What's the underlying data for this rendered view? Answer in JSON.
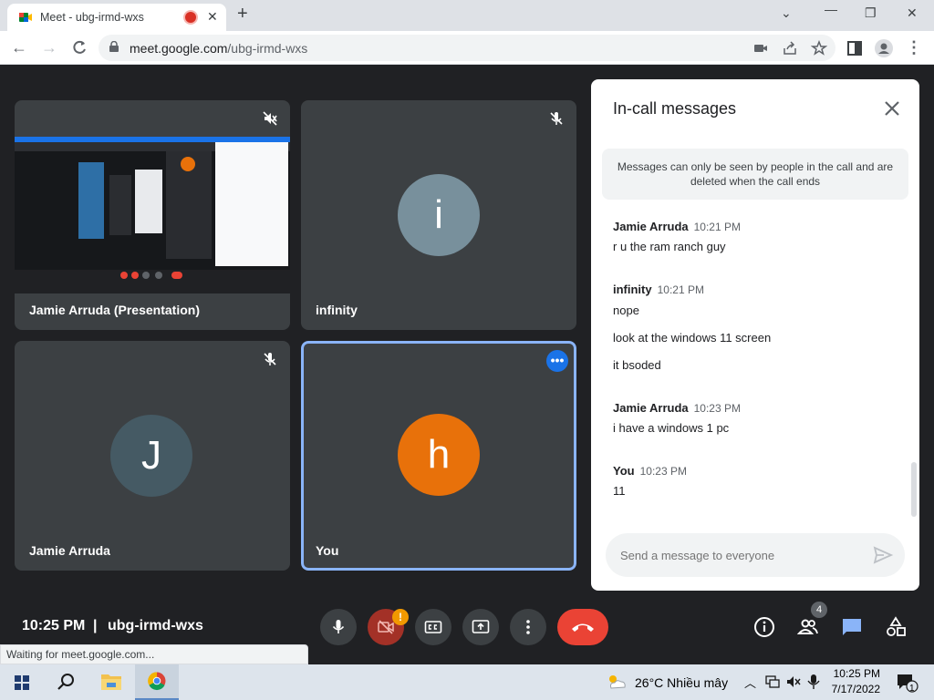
{
  "browser": {
    "tab_title": "Meet - ubg-irmd-wxs",
    "url_host": "meet.google.com",
    "url_path": "/ubg-irmd-wxs",
    "status_text": "Waiting for meet.google.com..."
  },
  "tiles": [
    {
      "name": "Jamie Arruda (Presentation)",
      "muted": true
    },
    {
      "name": "infinity",
      "initial": "i",
      "muted": true
    },
    {
      "name": "Jamie Arruda",
      "initial": "J",
      "muted": true
    },
    {
      "name": "You",
      "initial": "h"
    }
  ],
  "chat": {
    "title": "In-call messages",
    "notice": "Messages can only be seen by people in the call and are deleted when the call ends",
    "groups": [
      {
        "sender": "Jamie Arruda",
        "time": "10:21 PM",
        "messages": [
          "r u the ram ranch guy"
        ]
      },
      {
        "sender": "infinity",
        "time": "10:21 PM",
        "messages": [
          "nope",
          "look at the windows 11 screen",
          "it bsoded"
        ]
      },
      {
        "sender": "Jamie Arruda",
        "time": "10:23 PM",
        "messages": [
          "i have a windows 1 pc"
        ]
      },
      {
        "sender": "You",
        "time": "10:23 PM",
        "messages": [
          "11"
        ]
      }
    ],
    "input_placeholder": "Send a message to everyone"
  },
  "controls": {
    "clock": "10:25 PM",
    "separator": "|",
    "meeting_code": "ubg-irmd-wxs",
    "camera_warning": "!",
    "people_count": "4"
  },
  "taskbar": {
    "weather": "26°C  Nhiều mây",
    "time": "10:25 PM",
    "date": "7/17/2022",
    "notification_count": "1"
  },
  "colors": {
    "meet_bg": "#202124",
    "tile_bg": "#3c4043",
    "accent_blue": "#8ab4f8",
    "end_call_red": "#ea4335",
    "you_avatar": "#e8710a",
    "infinity_avatar": "#78909c",
    "jamie_avatar": "#455a64"
  }
}
